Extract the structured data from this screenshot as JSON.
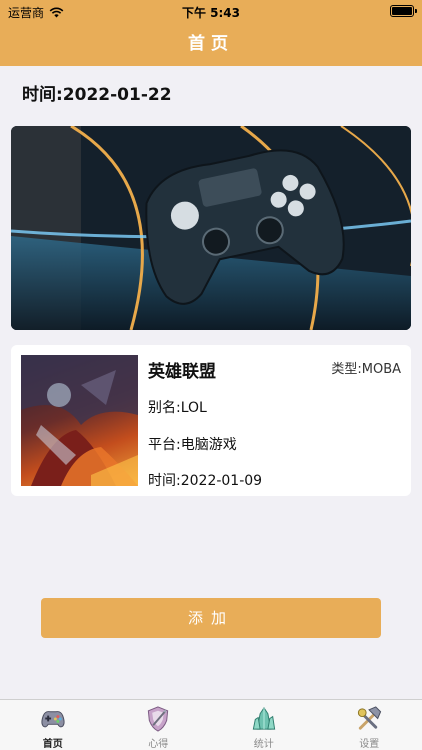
{
  "status_bar": {
    "carrier": "运营商",
    "time": "下午 5:43"
  },
  "nav": {
    "title": "首页"
  },
  "header": {
    "date": "时间:2022-01-22"
  },
  "game_card": {
    "name": "英雄联盟",
    "type": "类型:MOBA",
    "alias": "别名:LOL",
    "platform": "平台:电脑游戏",
    "date": "时间:2022-01-09"
  },
  "add_button": {
    "label": "添加"
  },
  "tabs": [
    {
      "label": "首页",
      "icon": "gamepad-icon",
      "active": true
    },
    {
      "label": "心得",
      "icon": "shield-sword-icon",
      "active": false
    },
    {
      "label": "统计",
      "icon": "crystal-icon",
      "active": false
    },
    {
      "label": "设置",
      "icon": "tools-icon",
      "active": false
    }
  ],
  "colors": {
    "accent": "#e8ad58",
    "background": "#f1f0f5"
  }
}
